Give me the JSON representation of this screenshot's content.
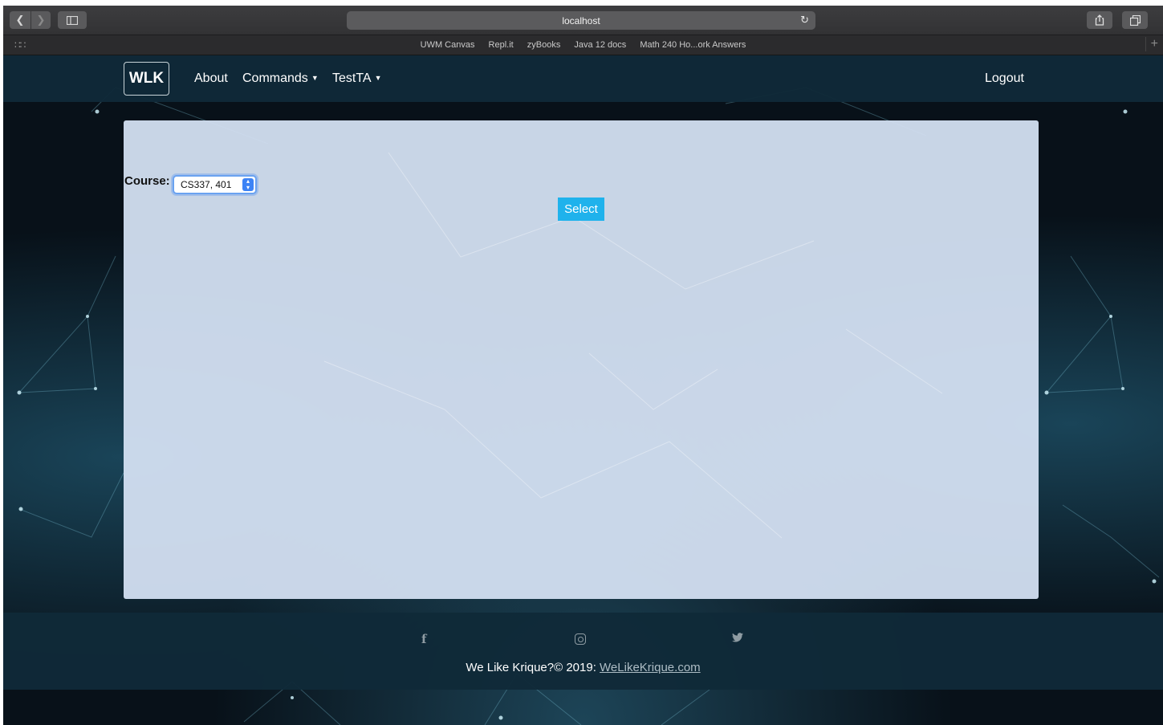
{
  "browser": {
    "url": "localhost",
    "bookmarks": [
      "UWM Canvas",
      "Repl.it",
      "zyBooks",
      "Java 12 docs",
      "Math 240 Ho...ork Answers"
    ]
  },
  "navbar": {
    "brand": "WLK",
    "about": "About",
    "commands": "Commands",
    "user": "TestTA",
    "logout": "Logout"
  },
  "form": {
    "course_label": "Course:",
    "course_value": "CS337, 401",
    "select_button": "Select"
  },
  "footer": {
    "copyright": "We Like Krique?© 2019: ",
    "link_text": "WeLikeKrique.com"
  },
  "colors": {
    "navbar_bg": "#102a38",
    "button_accent": "#1fb2ec",
    "panel_bg": "#d4e1f3"
  }
}
